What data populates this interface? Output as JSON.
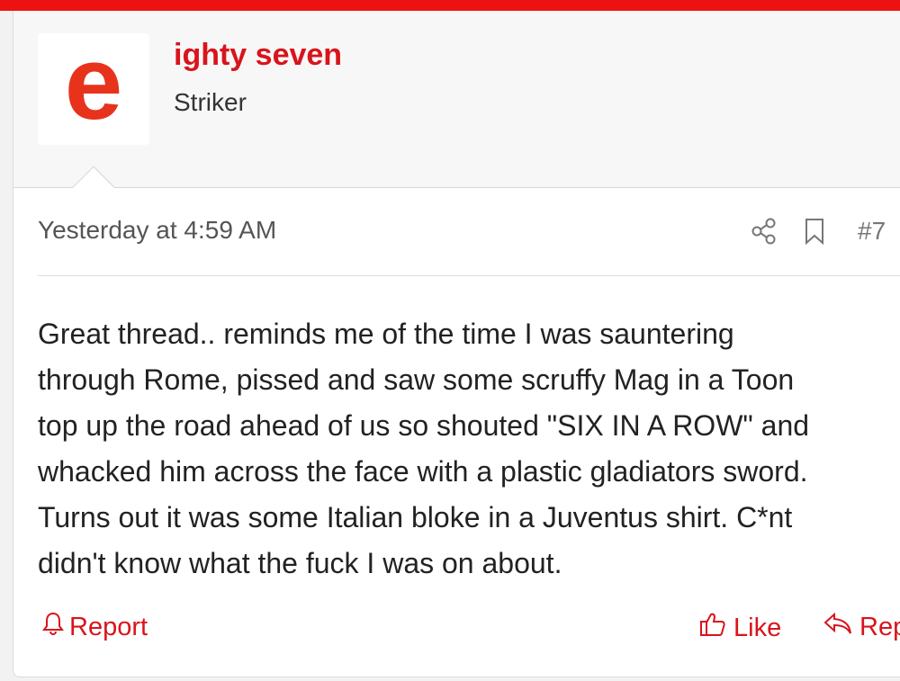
{
  "user": {
    "avatar_letter": "e",
    "name": "ighty seven",
    "title": "Striker"
  },
  "post": {
    "date": "Yesterday at 4:59 AM",
    "number": "#7",
    "message_lines": [
      "Great thread.. reminds me of the time I was sauntering",
      "through Rome, pissed and saw some scruffy Mag in a Toon",
      "top up the road ahead of us so shouted \"SIX IN A ROW\" and",
      "whacked him across the face with a plastic gladiators sword.",
      "Turns out it was some Italian bloke in a Juventus shirt. C*nt",
      "didn't know what the fuck I was on about."
    ]
  },
  "actions": {
    "report_label": "Report",
    "like_label": "Like",
    "reply_label": "Reply"
  },
  "icons": {
    "share": "share-icon",
    "bookmark": "bookmark-icon",
    "report": "bell-icon",
    "like": "thumbs-up-icon",
    "reply": "reply-icon"
  },
  "colors": {
    "brand_red": "#d9141c",
    "top_bar": "#ee1111",
    "avatar_letter": "#e8331c"
  }
}
